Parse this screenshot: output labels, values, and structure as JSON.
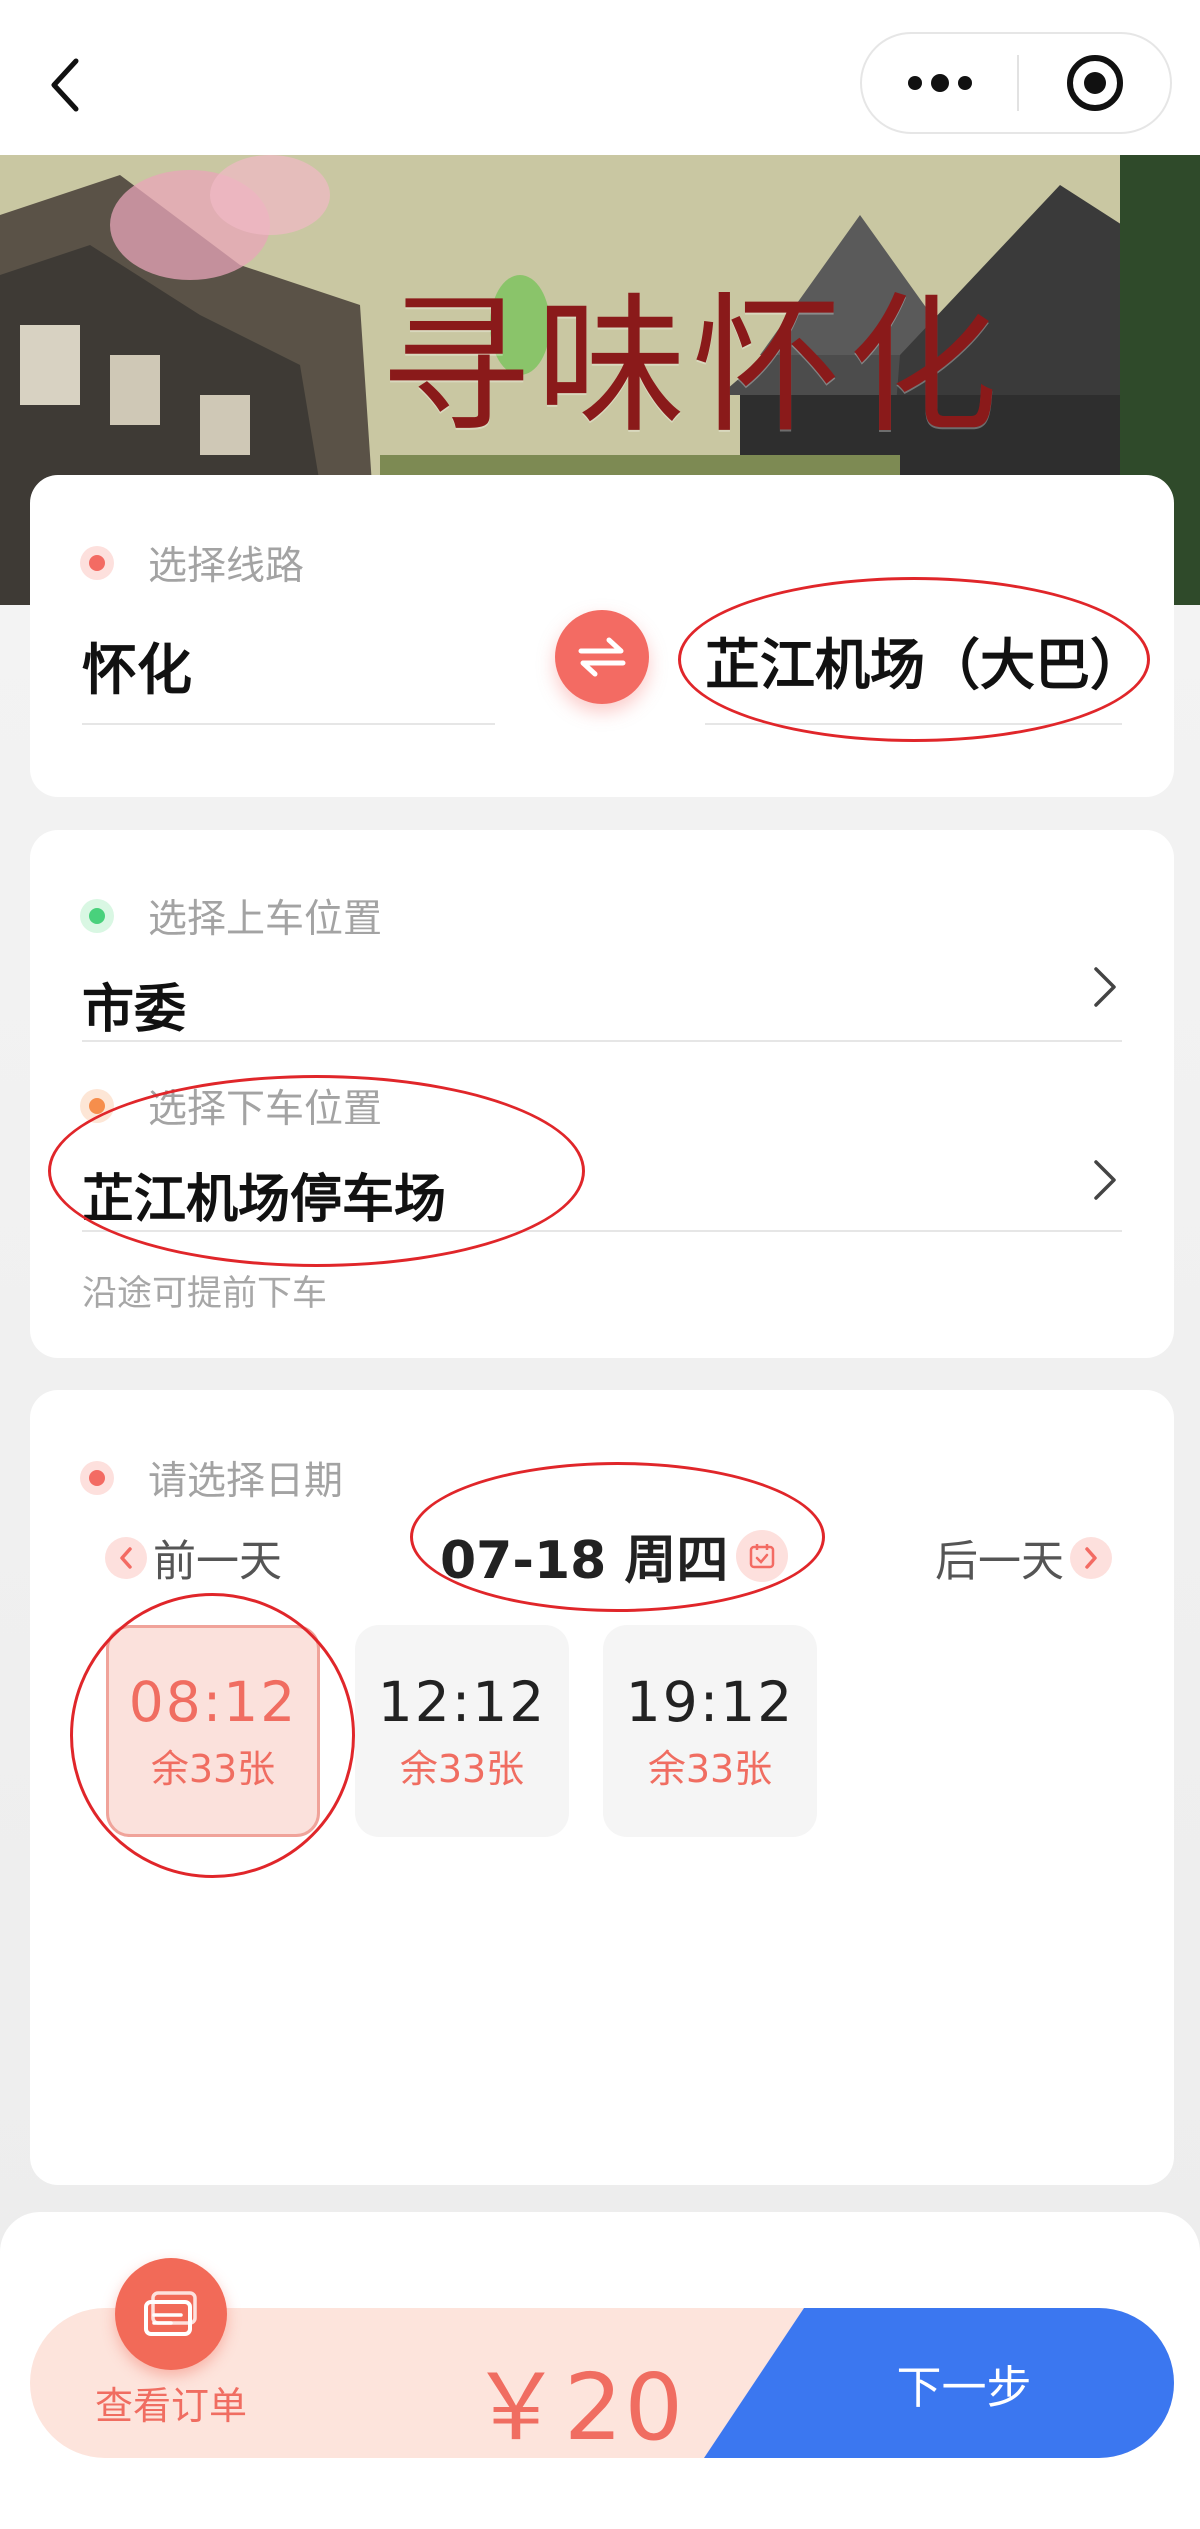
{
  "banner": {
    "title": "寻味怀化"
  },
  "route": {
    "section_label": "选择线路",
    "origin": "怀化",
    "destination": "芷江机场（大巴）"
  },
  "stops": {
    "pickup_label": "选择上车位置",
    "pickup_value": "市委",
    "dropoff_label": "选择下车位置",
    "dropoff_value": "芷江机场停车场",
    "hint": "沿途可提前下车"
  },
  "date": {
    "section_label": "请选择日期",
    "prev_label": "前一天",
    "next_label": "后一天",
    "current": "07-18 周四"
  },
  "slots": [
    {
      "time": "08:12",
      "remain": "余33张",
      "selected": true
    },
    {
      "time": "12:12",
      "remain": "余33张",
      "selected": false
    },
    {
      "time": "19:12",
      "remain": "余33张",
      "selected": false
    }
  ],
  "footer": {
    "orders_label": "查看订单",
    "price": "￥20",
    "next_label": "下一步"
  },
  "colors": {
    "accent": "#f36b63",
    "primary_button": "#3b77f0",
    "annotation": "#e0262a"
  }
}
